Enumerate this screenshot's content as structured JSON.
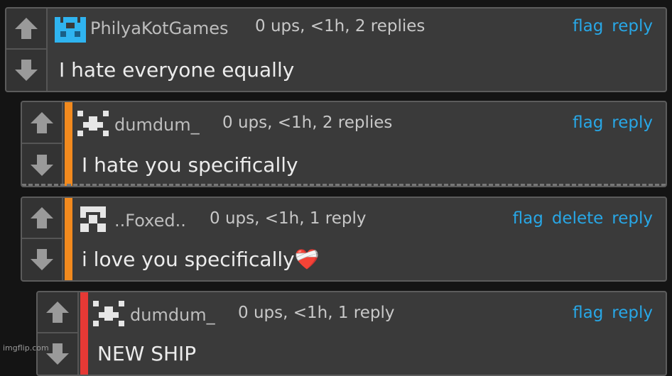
{
  "colors": {
    "link": "#28a7e6",
    "stripe_orange": "#f28a1e",
    "stripe_red": "#e53935",
    "avatar_cyan": "#2fb4f0",
    "avatar_white": "#e6e6e6"
  },
  "comments": [
    {
      "username": "PhilyaKotGames",
      "meta": "0 ups, <1h, 2 replies",
      "actions": [
        "flag",
        "reply"
      ],
      "text": "I hate everyone equally",
      "avatar_icon": "cyan-pixel-avatar-icon"
    },
    {
      "username": "dumdum_",
      "meta": "0 ups, <1h, 2 replies",
      "actions": [
        "flag",
        "reply"
      ],
      "text": "I hate you specifically",
      "avatar_icon": "white-pixel-avatar-icon"
    },
    {
      "username": "..Foxed..",
      "meta": "0 ups, <1h, 1 reply",
      "actions": [
        "flag",
        "delete",
        "reply"
      ],
      "text": "i love you specifically",
      "emoji": "❤️‍🩹",
      "avatar_icon": "white-pixel-avatar-icon"
    },
    {
      "username": "dumdum_",
      "meta": "0 ups, <1h, 1 reply",
      "actions": [
        "flag",
        "reply"
      ],
      "text": "NEW SHIP",
      "avatar_icon": "white-pixel-avatar-icon"
    }
  ],
  "watermark": "imgflip.com"
}
